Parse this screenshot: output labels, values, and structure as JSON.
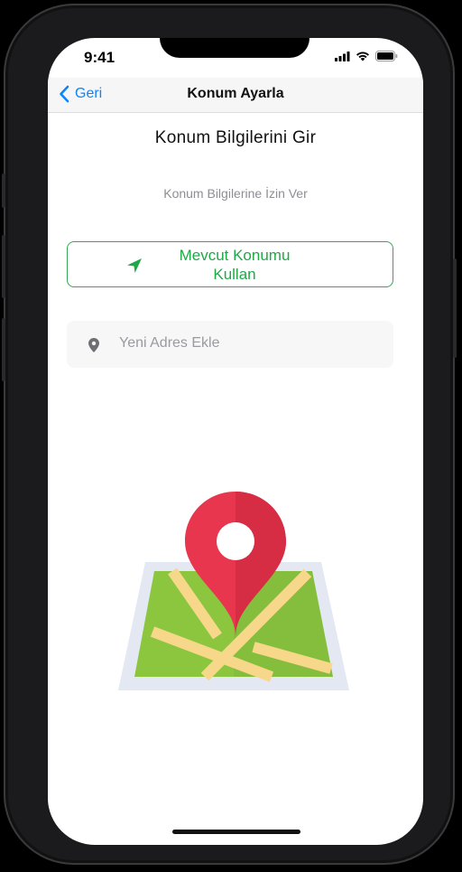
{
  "status_bar": {
    "time": "9:41"
  },
  "nav": {
    "back_label": "Geri",
    "title": "Konum Ayarla"
  },
  "content": {
    "heading": "Konum Bilgilerini Gir",
    "subtitle": "Konum Bilgilerine İzin Ver",
    "use_location_line1": "Mevcut Konumu",
    "use_location_line2": "Kullan",
    "address_placeholder": "Yeni Adres Ekle"
  },
  "colors": {
    "accent_blue": "#0a84ff",
    "accent_green": "#1fa847",
    "pin_red": "#e8364e",
    "map_green": "#8cc63f",
    "road_yellow": "#f7d88a"
  },
  "icons": [
    "chevron-left-icon",
    "signal-icon",
    "wifi-icon",
    "battery-icon",
    "location-arrow-icon",
    "map-pin-icon",
    "map-illustration"
  ]
}
